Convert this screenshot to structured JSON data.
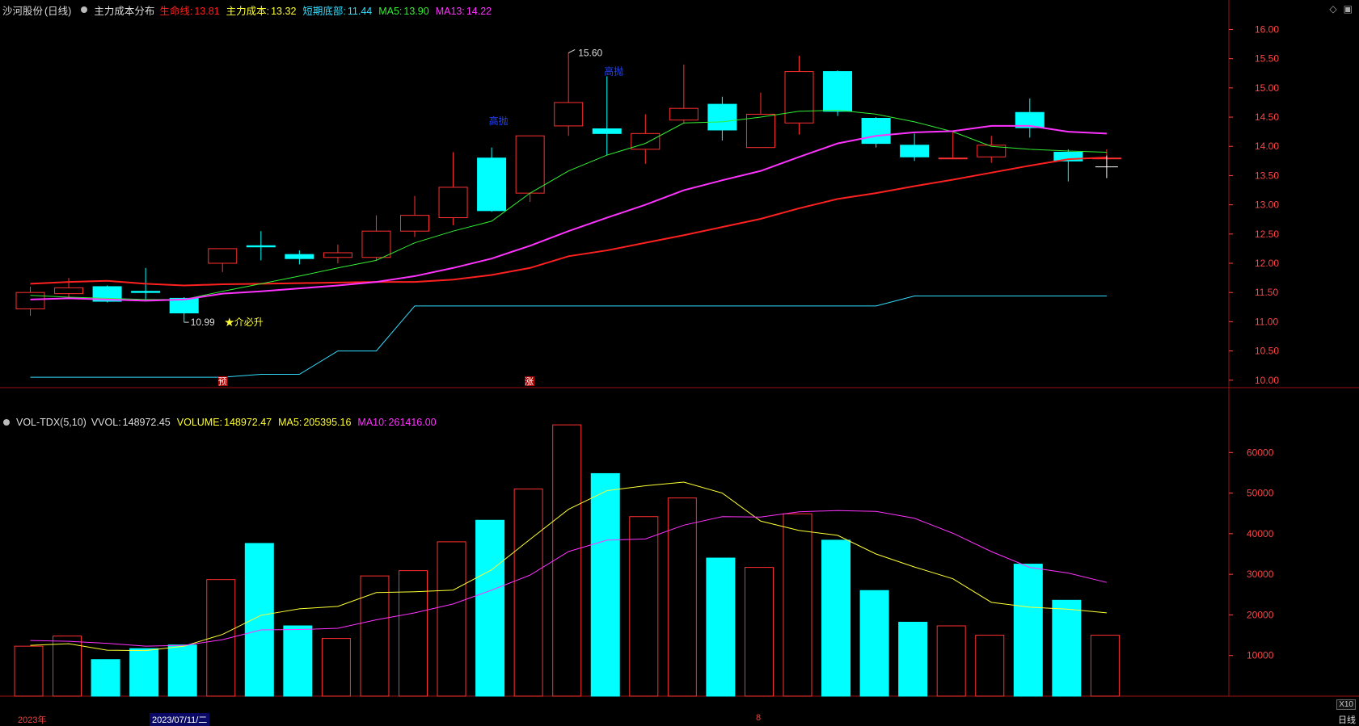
{
  "stock": {
    "name": "沙河股份",
    "period": "(日线)"
  },
  "price_header": {
    "indicator_name": "主力成本分布",
    "items": [
      {
        "label": "生命线:",
        "value": "13.81",
        "color": "#ff2020"
      },
      {
        "label": "主力成本:",
        "value": "13.32",
        "color": "#ffff33"
      },
      {
        "label": "短期底部:",
        "value": "11.44",
        "color": "#33ddff"
      },
      {
        "label": "MA5:",
        "value": "13.90",
        "color": "#33ee33"
      },
      {
        "label": "MA13:",
        "value": "14.22",
        "color": "#ff33ff"
      }
    ]
  },
  "vol_header": {
    "name": "VOL-TDX(5,10)",
    "items": [
      {
        "label": "VVOL:",
        "value": "148972.45",
        "color": "#dddddd"
      },
      {
        "label": "VOLUME:",
        "value": "148972.47",
        "color": "#ffff33"
      },
      {
        "label": "MA5:",
        "value": "205395.16",
        "color": "#ffff33"
      },
      {
        "label": "MA10:",
        "value": "261416.00",
        "color": "#ff33ff"
      }
    ]
  },
  "icons": {
    "diamond": "diamond-icon",
    "window": "window-icon"
  },
  "annotations": {
    "high": "15.60",
    "low": "10.99",
    "signal": "★介必升",
    "tag_blue_1": "高抛",
    "tag_blue_2": "高抛",
    "marker_1": "预",
    "marker_2": "涨"
  },
  "x_labels": {
    "year": "2023年",
    "cursor_date": "2023/07/11/二",
    "month": "8",
    "x10": "X10",
    "period_tab": "日线"
  },
  "colors": {
    "up": "#ff3030",
    "down": "#00ffff",
    "grid": "#6a0000",
    "axis_text": "#ff4444"
  },
  "chart_data": [
    {
      "type": "candlestick",
      "y_ticks": [
        "10.00",
        "10.50",
        "11.00",
        "11.50",
        "12.00",
        "12.50",
        "13.00",
        "13.50",
        "14.00",
        "14.50",
        "15.00",
        "15.50",
        "16.00"
      ],
      "ylim": [
        9.9,
        16.2
      ],
      "candles": [
        {
          "o": 11.22,
          "c": 11.5,
          "h": 11.6,
          "l": 11.1
        },
        {
          "o": 11.48,
          "c": 11.58,
          "h": 11.75,
          "l": 11.42
        },
        {
          "o": 11.6,
          "c": 11.35,
          "h": 11.62,
          "l": 11.33
        },
        {
          "o": 11.52,
          "c": 11.5,
          "h": 11.92,
          "l": 11.38
        },
        {
          "o": 11.4,
          "c": 11.15,
          "h": 11.42,
          "l": 10.99
        },
        {
          "o": 12.0,
          "c": 12.25,
          "h": 12.25,
          "l": 11.85
        },
        {
          "o": 12.3,
          "c": 12.28,
          "h": 12.55,
          "l": 12.05
        },
        {
          "o": 12.15,
          "c": 12.08,
          "h": 12.22,
          "l": 11.98
        },
        {
          "o": 12.1,
          "c": 12.18,
          "h": 12.32,
          "l": 12.0
        },
        {
          "o": 12.1,
          "c": 12.55,
          "h": 12.82,
          "l": 12.05
        },
        {
          "o": 12.55,
          "c": 12.82,
          "h": 13.15,
          "l": 12.45
        },
        {
          "o": 12.78,
          "c": 13.3,
          "h": 13.9,
          "l": 12.65
        },
        {
          "o": 13.8,
          "c": 12.9,
          "h": 13.98,
          "l": 12.88
        },
        {
          "o": 13.2,
          "c": 14.18,
          "h": 14.18,
          "l": 13.05
        },
        {
          "o": 14.35,
          "c": 14.75,
          "h": 15.6,
          "l": 14.18
        },
        {
          "o": 14.3,
          "c": 14.22,
          "h": 15.2,
          "l": 13.85
        },
        {
          "o": 13.95,
          "c": 14.22,
          "h": 14.55,
          "l": 13.7
        },
        {
          "o": 14.45,
          "c": 14.65,
          "h": 15.4,
          "l": 14.4
        },
        {
          "o": 14.72,
          "c": 14.28,
          "h": 14.85,
          "l": 14.1
        },
        {
          "o": 13.98,
          "c": 14.55,
          "h": 14.92,
          "l": 13.98
        },
        {
          "o": 14.4,
          "c": 15.28,
          "h": 15.55,
          "l": 14.2
        },
        {
          "o": 15.28,
          "c": 14.6,
          "h": 15.3,
          "l": 14.52
        },
        {
          "o": 14.48,
          "c": 14.05,
          "h": 14.5,
          "l": 13.98
        },
        {
          "o": 14.02,
          "c": 13.82,
          "h": 14.22,
          "l": 13.75
        },
        {
          "o": 13.8,
          "c": 13.8,
          "h": 14.25,
          "l": 13.78
        },
        {
          "o": 13.82,
          "c": 14.02,
          "h": 14.18,
          "l": 13.72
        },
        {
          "o": 14.58,
          "c": 14.32,
          "h": 14.82,
          "l": 14.15
        },
        {
          "o": 13.9,
          "c": 13.75,
          "h": 13.95,
          "l": 13.4
        },
        {
          "o": 13.8,
          "c": 13.8,
          "h": 13.95,
          "l": 13.65
        }
      ],
      "series": [
        {
          "name": "生命线",
          "color": "#ff2020",
          "values": [
            11.65,
            11.68,
            11.7,
            11.65,
            11.62,
            11.64,
            11.65,
            11.66,
            11.67,
            11.68,
            11.68,
            11.72,
            11.8,
            11.92,
            12.12,
            12.22,
            12.35,
            12.48,
            12.62,
            12.76,
            12.94,
            13.1,
            13.2,
            13.32,
            13.43,
            13.55,
            13.67,
            13.78,
            13.81
          ]
        },
        {
          "name": "MA5",
          "color": "#33ee33",
          "values": [
            11.45,
            11.42,
            11.4,
            11.38,
            11.38,
            11.52,
            11.65,
            11.78,
            11.92,
            12.05,
            12.35,
            12.55,
            12.72,
            13.2,
            13.58,
            13.85,
            14.05,
            14.4,
            14.42,
            14.5,
            14.6,
            14.62,
            14.55,
            14.42,
            14.25,
            14.0,
            13.95,
            13.92,
            13.9
          ]
        },
        {
          "name": "MA13",
          "color": "#ff33ff",
          "values": [
            11.38,
            11.4,
            11.38,
            11.36,
            11.38,
            11.48,
            11.52,
            11.57,
            11.62,
            11.68,
            11.78,
            11.92,
            12.08,
            12.3,
            12.55,
            12.78,
            13.0,
            13.25,
            13.42,
            13.58,
            13.82,
            14.05,
            14.18,
            14.24,
            14.26,
            14.35,
            14.35,
            14.25,
            14.22
          ]
        },
        {
          "name": "短期底部",
          "color": "#33ddff",
          "values": [
            10.05,
            10.05,
            10.05,
            10.05,
            10.05,
            10.05,
            10.1,
            10.1,
            10.5,
            10.5,
            11.27,
            11.27,
            11.27,
            11.27,
            11.27,
            11.27,
            11.27,
            11.27,
            11.27,
            11.27,
            11.27,
            11.27,
            11.27,
            11.44,
            11.44,
            11.44,
            11.44,
            11.44,
            11.44
          ]
        }
      ]
    },
    {
      "type": "bar",
      "y_ticks": [
        "10000",
        "20000",
        "30000",
        "40000",
        "50000",
        "60000"
      ],
      "ylim": [
        0,
        70000
      ],
      "values": [
        12300,
        14800,
        9000,
        11700,
        12600,
        28700,
        37600,
        17300,
        14200,
        29600,
        30900,
        38000,
        43300,
        51000,
        66800,
        54800,
        44200,
        48800,
        34000,
        31700,
        44900,
        38400,
        26000,
        18200,
        17300,
        15000,
        32500,
        23600,
        15000
      ],
      "series": [
        {
          "name": "MA5",
          "color": "#ffff33",
          "values": [
            12500,
            12900,
            11300,
            11200,
            12300,
            15200,
            19900,
            21500,
            22100,
            25500,
            25700,
            26100,
            31100,
            38600,
            46000,
            50600,
            51800,
            52700,
            50000,
            43100,
            40800,
            39600,
            35000,
            31800,
            28900,
            23100,
            21900,
            21400,
            20500
          ]
        },
        {
          "name": "MA10",
          "color": "#ff33ff",
          "values": [
            13700,
            13500,
            13000,
            12300,
            12500,
            13900,
            16300,
            16400,
            16700,
            18800,
            20500,
            22700,
            26100,
            29800,
            35600,
            38400,
            38700,
            42100,
            44200,
            44100,
            45400,
            45700,
            45500,
            43800,
            40100,
            35600,
            31700,
            30300,
            28000,
            26100
          ]
        }
      ]
    }
  ]
}
